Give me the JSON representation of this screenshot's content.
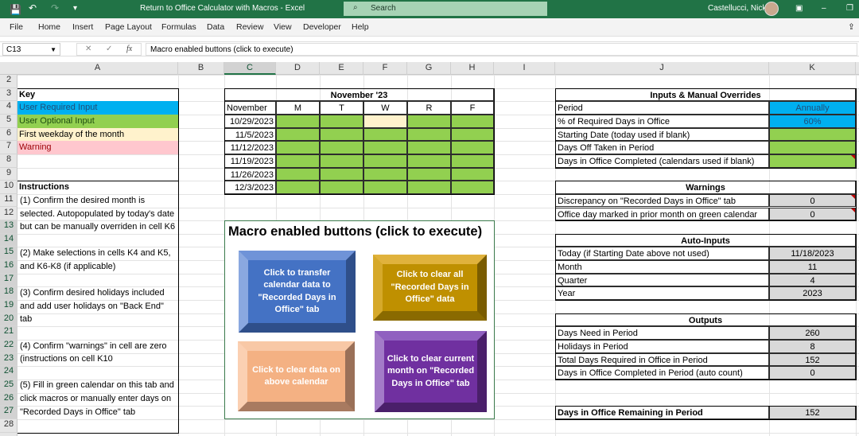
{
  "titlebar": {
    "title": "Return to Office Calculator with Macros  -  Excel",
    "search_placeholder": "Search",
    "user": "Castellucci, Nick"
  },
  "menu": [
    "File",
    "Home",
    "Insert",
    "Page Layout",
    "Formulas",
    "Data",
    "Review",
    "View",
    "Developer",
    "Help"
  ],
  "formula_bar": {
    "name_box": "C13",
    "formula": "Macro enabled buttons (click to execute)"
  },
  "columns": [
    "A",
    "B",
    "C",
    "D",
    "E",
    "F",
    "G",
    "H",
    "I",
    "J",
    "K"
  ],
  "selected_cell": {
    "col": "C",
    "row": 13
  },
  "rows": [
    2,
    3,
    4,
    5,
    6,
    7,
    8,
    9,
    10,
    11,
    12,
    13,
    14,
    15,
    16,
    17,
    18,
    19,
    20,
    21,
    22,
    23,
    24,
    25,
    26,
    27,
    28
  ],
  "colors": {
    "required": "#00B0F0",
    "optional": "#92D050",
    "first_weekday": "#FFF2CC",
    "warning": "#FFC7CE",
    "auto": "#D9D9D9",
    "accent": "#217346"
  },
  "cells": [
    {
      "ref": "A3",
      "text": "Key",
      "bold": true
    },
    {
      "ref": "A4",
      "text": "User Required Input",
      "fill": "#00B0F0",
      "color": "#1F4E79"
    },
    {
      "ref": "A5",
      "text": "User Optional Input",
      "fill": "#92D050",
      "color": "#1e4d10"
    },
    {
      "ref": "A6",
      "text": "First weekday of the month",
      "fill": "#FFF2CC"
    },
    {
      "ref": "A7",
      "text": "Warning",
      "fill": "#FFC7CE",
      "color": "#9C0006"
    },
    {
      "ref": "A10",
      "text": "Instructions",
      "bold": true
    },
    {
      "ref": "C3",
      "span": "C3:H3",
      "text": "November '23",
      "bold": true,
      "align": "center"
    },
    {
      "ref": "C4",
      "text": "November"
    },
    {
      "ref": "D4",
      "text": "M",
      "align": "center"
    },
    {
      "ref": "E4",
      "text": "T",
      "align": "center"
    },
    {
      "ref": "F4",
      "text": "W",
      "align": "center"
    },
    {
      "ref": "G4",
      "text": "R",
      "align": "center"
    },
    {
      "ref": "H4",
      "text": "F",
      "align": "center"
    },
    {
      "ref": "C5",
      "text": "10/29/2023",
      "align": "right"
    },
    {
      "ref": "C6",
      "text": "11/5/2023",
      "align": "right"
    },
    {
      "ref": "C7",
      "text": "11/12/2023",
      "align": "right"
    },
    {
      "ref": "C8",
      "text": "11/19/2023",
      "align": "right"
    },
    {
      "ref": "C9",
      "text": "11/26/2023",
      "align": "right"
    },
    {
      "ref": "C10",
      "text": "12/3/2023",
      "align": "right"
    },
    {
      "ref": "J3",
      "span": "J3:K3",
      "text": "Inputs & Manual Overrides",
      "bold": true,
      "align": "center"
    },
    {
      "ref": "J4",
      "text": "Period"
    },
    {
      "ref": "K4",
      "text": "Annually",
      "fill": "#00B0F0",
      "align": "center",
      "color": "#1F4E79"
    },
    {
      "ref": "J5",
      "text": "% of Required Days in Office"
    },
    {
      "ref": "K5",
      "text": "60%",
      "fill": "#00B0F0",
      "align": "center",
      "color": "#1F4E79"
    },
    {
      "ref": "J6",
      "text": "Starting Date (today used if blank)"
    },
    {
      "ref": "K6",
      "text": "",
      "fill": "#92D050"
    },
    {
      "ref": "J7",
      "text": "Days Off Taken in Period"
    },
    {
      "ref": "K7",
      "text": "",
      "fill": "#92D050"
    },
    {
      "ref": "J8",
      "text": "Days in Office Completed (calendars used if blank)"
    },
    {
      "ref": "K8",
      "text": "",
      "fill": "#92D050",
      "comment": true
    },
    {
      "ref": "J10",
      "span": "J10:K10",
      "text": "Warnings",
      "bold": true,
      "align": "center"
    },
    {
      "ref": "J11",
      "text": "Discrepancy on \"Recorded Days in Office\" tab"
    },
    {
      "ref": "K11",
      "text": "0",
      "fill": "#D9D9D9",
      "align": "center",
      "comment": true
    },
    {
      "ref": "J12",
      "text": "Office day marked in prior month on green calendar"
    },
    {
      "ref": "K12",
      "text": "0",
      "fill": "#D9D9D9",
      "align": "center",
      "comment": true
    },
    {
      "ref": "J14",
      "span": "J14:K14",
      "text": "Auto-Inputs",
      "bold": true,
      "align": "center"
    },
    {
      "ref": "J15",
      "text": "Today (if Starting Date above not used)"
    },
    {
      "ref": "K15",
      "text": "11/18/2023",
      "fill": "#D9D9D9",
      "align": "center"
    },
    {
      "ref": "J16",
      "text": "Month"
    },
    {
      "ref": "K16",
      "text": "11",
      "fill": "#D9D9D9",
      "align": "center"
    },
    {
      "ref": "J17",
      "text": "Quarter"
    },
    {
      "ref": "K17",
      "text": "4",
      "fill": "#D9D9D9",
      "align": "center"
    },
    {
      "ref": "J18",
      "text": "Year"
    },
    {
      "ref": "K18",
      "text": "2023",
      "fill": "#D9D9D9",
      "align": "center"
    },
    {
      "ref": "J20",
      "span": "J20:K20",
      "text": "Outputs",
      "bold": true,
      "align": "center"
    },
    {
      "ref": "J21",
      "text": "Days Need in Period"
    },
    {
      "ref": "K21",
      "text": "260",
      "fill": "#D9D9D9",
      "align": "center"
    },
    {
      "ref": "J22",
      "text": "Holidays in Period"
    },
    {
      "ref": "K22",
      "text": "8",
      "fill": "#D9D9D9",
      "align": "center"
    },
    {
      "ref": "J23",
      "text": "Total Days Required in Office in Period"
    },
    {
      "ref": "K23",
      "text": "152",
      "fill": "#D9D9D9",
      "align": "center"
    },
    {
      "ref": "J24",
      "text": "Days in Office Completed in Period (auto count)"
    },
    {
      "ref": "K24",
      "text": "0",
      "fill": "#D9D9D9",
      "align": "center"
    },
    {
      "ref": "J27",
      "text": "Days in Office Remaining in Period",
      "bold": true
    },
    {
      "ref": "K27",
      "text": "152",
      "fill": "#D9D9D9",
      "align": "center"
    }
  ],
  "calendar_fills": {
    "green": "#92D050",
    "first_weekday_cell": "F5",
    "range": "D5:H10"
  },
  "instructions": "(1) Confirm the desired month is selected. Autopopulated by today's date but can be manually overriden in cell K6\n\n(2) Make selections in cells K4 and K5, and K6-K8 (if applicable)\n\n(3) Confirm desired holidays included and add user holidays on \"Back End\" tab\n\n(4) Confirm \"warnings\" in cell are zero (instructions on cell K10\n\n(5) Fill in green calendar on this tab and click macros or manually enter days on \"Recorded Days in Office\" tab",
  "macros": {
    "title": "Macro enabled buttons (click to execute)",
    "buttons": [
      {
        "label": "Click to transfer calendar data to \"Recorded Days in Office\" tab",
        "color": "#4472C4"
      },
      {
        "label": "Click to clear all \"Recorded Days in Office\" data",
        "color": "#BF9000"
      },
      {
        "label": "Click to clear data on above calendar",
        "color": "#F4B183"
      },
      {
        "label": "Click to clear current month  on \"Recorded Days in Office\" tab",
        "color": "#7030A0"
      }
    ]
  }
}
